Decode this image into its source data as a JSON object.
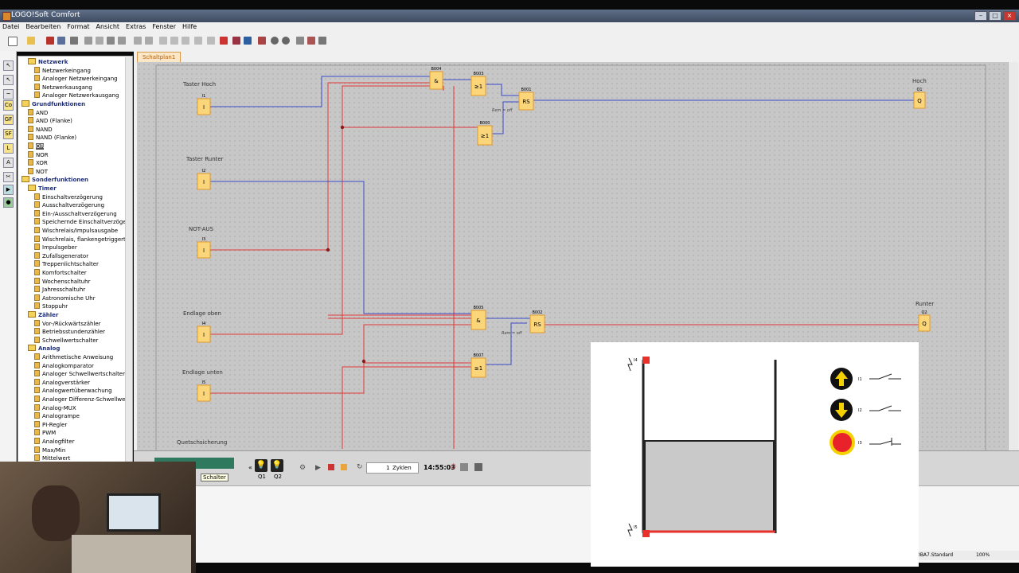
{
  "window": {
    "title": "LOGO!Soft Comfort"
  },
  "menu": [
    "Datei",
    "Bearbeiten",
    "Format",
    "Ansicht",
    "Extras",
    "Fenster",
    "Hilfe"
  ],
  "tab": {
    "label": "Schaltplan1"
  },
  "tree": [
    {
      "label": "Netzwerk",
      "level": 1,
      "group": true
    },
    {
      "label": "Netzwerkeingang",
      "level": 2
    },
    {
      "label": "Analoger Netzwerkeingang",
      "level": 2
    },
    {
      "label": "Netzwerkausgang",
      "level": 2
    },
    {
      "label": "Analoger Netzwerkausgang",
      "level": 2
    },
    {
      "label": "Grundfunktionen",
      "level": 0,
      "group": true
    },
    {
      "label": "AND",
      "level": 1
    },
    {
      "label": "AND (Flanke)",
      "level": 1
    },
    {
      "label": "NAND",
      "level": 1
    },
    {
      "label": "NAND (Flanke)",
      "level": 1
    },
    {
      "label": "OR",
      "level": 1,
      "selected": true
    },
    {
      "label": "NOR",
      "level": 1
    },
    {
      "label": "XOR",
      "level": 1
    },
    {
      "label": "NOT",
      "level": 1
    },
    {
      "label": "Sonderfunktionen",
      "level": 0,
      "group": true
    },
    {
      "label": "Timer",
      "level": 1,
      "group": true
    },
    {
      "label": "Einschaltverzögerung",
      "level": 2
    },
    {
      "label": "Ausschaltverzögerung",
      "level": 2
    },
    {
      "label": "Ein-/Ausschaltverzögerung",
      "level": 2
    },
    {
      "label": "Speichernde Einschaltverzögerung",
      "level": 2
    },
    {
      "label": "Wischrelais/Impulsausgabe",
      "level": 2
    },
    {
      "label": "Wischrelais, flankengetriggert",
      "level": 2
    },
    {
      "label": "Impulsgeber",
      "level": 2
    },
    {
      "label": "Zufallsgenerator",
      "level": 2
    },
    {
      "label": "Treppenlichtschalter",
      "level": 2
    },
    {
      "label": "Komfortschalter",
      "level": 2
    },
    {
      "label": "Wochenschaltuhr",
      "level": 2
    },
    {
      "label": "Jahresschaltuhr",
      "level": 2
    },
    {
      "label": "Astronomische Uhr",
      "level": 2
    },
    {
      "label": "Stoppuhr",
      "level": 2
    },
    {
      "label": "Zähler",
      "level": 1,
      "group": true
    },
    {
      "label": "Vor-/Rückwärtszähler",
      "level": 2
    },
    {
      "label": "Betriebsstundenzähler",
      "level": 2
    },
    {
      "label": "Schwellwertschalter",
      "level": 2
    },
    {
      "label": "Analog",
      "level": 1,
      "group": true
    },
    {
      "label": "Arithmetische Anweisung",
      "level": 2
    },
    {
      "label": "Analogkomparator",
      "level": 2
    },
    {
      "label": "Analoger Schwellwertschalter",
      "level": 2
    },
    {
      "label": "Analogverstärker",
      "level": 2
    },
    {
      "label": "Analogwertüberwachung",
      "level": 2
    },
    {
      "label": "Analoger Differenz-Schwellwer",
      "level": 2
    },
    {
      "label": "Analog-MUX",
      "level": 2
    },
    {
      "label": "Analogrampe",
      "level": 2
    },
    {
      "label": "PI-Regler",
      "level": 2
    },
    {
      "label": "PWM",
      "level": 2
    },
    {
      "label": "Analogfilter",
      "level": 2
    },
    {
      "label": "Max/Min",
      "level": 2
    },
    {
      "label": "Mittelwert",
      "level": 2
    }
  ],
  "inputs": [
    {
      "name": "Taster Hoch",
      "id": "I1",
      "glyph": "I"
    },
    {
      "name": "Taster Runter",
      "id": "I2",
      "glyph": "I"
    },
    {
      "name": "NOT-AUS",
      "id": "I3",
      "glyph": "I"
    },
    {
      "name": "Endlage oben",
      "id": "I4",
      "glyph": "I"
    },
    {
      "name": "Endlage unten",
      "id": "I5",
      "glyph": "I"
    },
    {
      "name": "Quetschsicherung",
      "id": "",
      "glyph": ""
    }
  ],
  "outputs": [
    {
      "name": "Hoch",
      "id": "Q1",
      "glyph": "Q"
    },
    {
      "name": "Runter",
      "id": "Q2",
      "glyph": "Q"
    }
  ],
  "blocks": [
    {
      "id": "B004",
      "glyph": "&"
    },
    {
      "id": "B003",
      "glyph": "≥1"
    },
    {
      "id": "B001",
      "glyph": "RS"
    },
    {
      "id": "B000",
      "glyph": "≥1"
    },
    {
      "id": "B005",
      "glyph": "&"
    },
    {
      "id": "B002",
      "glyph": "RS"
    },
    {
      "id": "B007",
      "glyph": "≥1"
    }
  ],
  "rem_label": "Rem = off",
  "sim": {
    "outputs": [
      "Q1",
      "Q2"
    ],
    "cycles": "1",
    "cycles_unit": "Zyklen",
    "time": "14:55:03",
    "schalter_label": "Schalter"
  },
  "status": {
    "profile": "0BA7.Standard",
    "zoom": "100%"
  },
  "overlay": {
    "sensor_top": "I4",
    "sensor_bottom": "I5",
    "controls": [
      {
        "label": "I1",
        "icon": "up-arrow-icon"
      },
      {
        "label": "I2",
        "icon": "down-arrow-icon"
      },
      {
        "label": "I3",
        "icon": "emergency-stop-icon"
      }
    ]
  },
  "colors": {
    "block_fill": "#fbd57a",
    "block_border": "#e09a2a",
    "wire_blue": "#3b4bc8",
    "wire_red": "#e03a36",
    "active_red": "#e8312b"
  }
}
